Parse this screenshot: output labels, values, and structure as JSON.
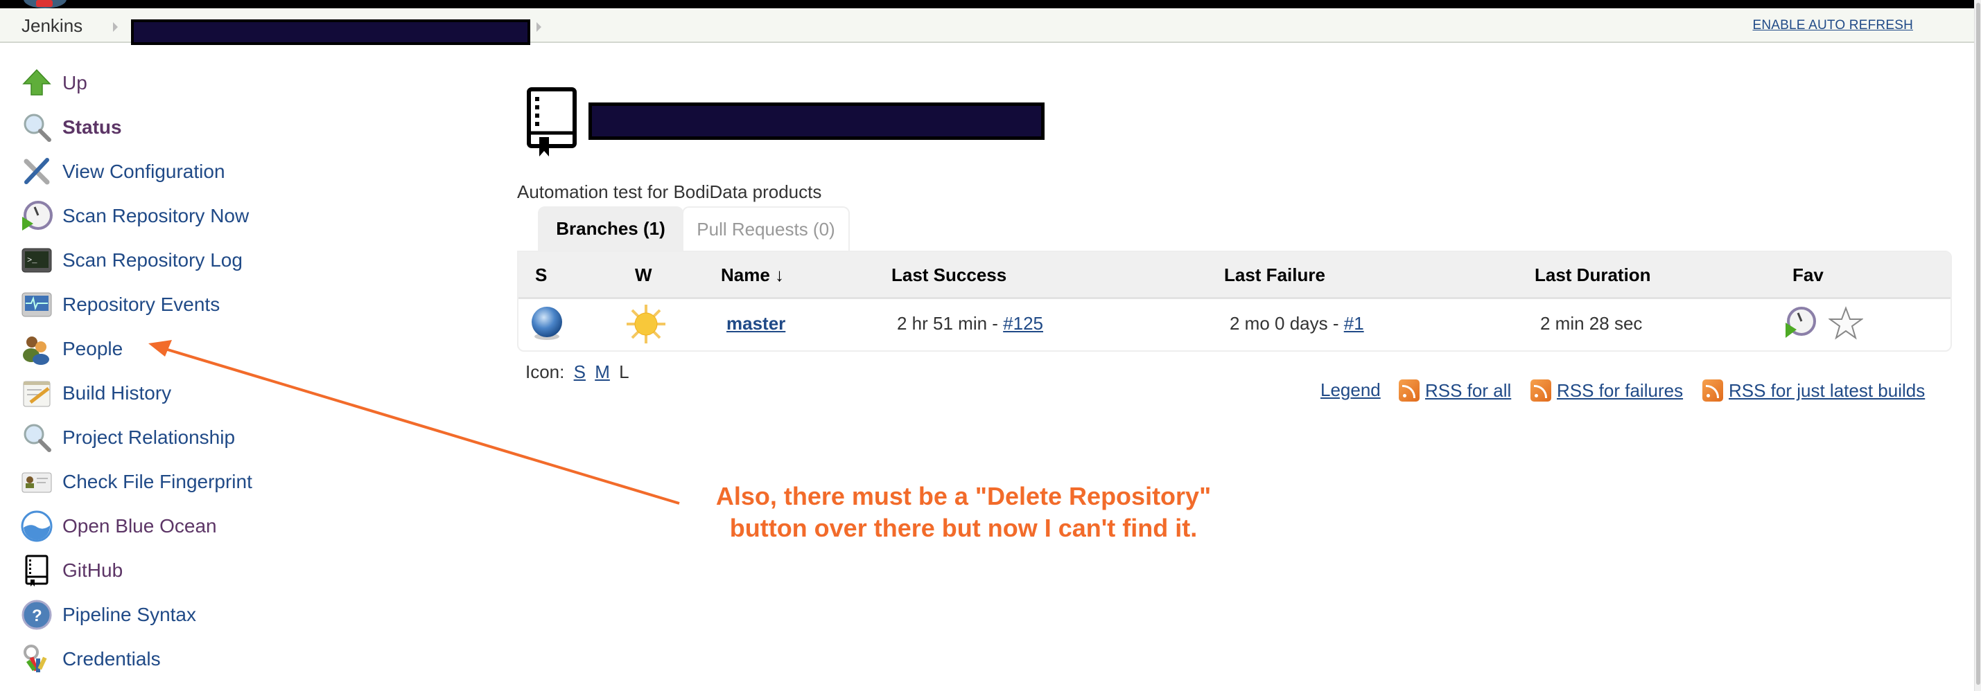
{
  "breadcrumb": {
    "root": "Jenkins",
    "redacted_item": "[redacted]",
    "auto_refresh": "ENABLE AUTO REFRESH"
  },
  "sidebar": {
    "items": [
      {
        "label": "Up",
        "icon": "up-arrow-icon",
        "visited": true
      },
      {
        "label": "Status",
        "icon": "magnifier-icon",
        "visited": true,
        "current": true
      },
      {
        "label": "View Configuration",
        "icon": "tools-icon"
      },
      {
        "label": "Scan Repository Now",
        "icon": "clock-play-icon"
      },
      {
        "label": "Scan Repository Log",
        "icon": "terminal-icon"
      },
      {
        "label": "Repository Events",
        "icon": "monitor-pulse-icon"
      },
      {
        "label": "People",
        "icon": "people-icon"
      },
      {
        "label": "Build History",
        "icon": "notepad-icon"
      },
      {
        "label": "Project Relationship",
        "icon": "magnifier-icon"
      },
      {
        "label": "Check File Fingerprint",
        "icon": "fingerprint-card-icon"
      },
      {
        "label": "Open Blue Ocean",
        "icon": "blue-ocean-icon",
        "visited": true
      },
      {
        "label": "GitHub",
        "icon": "repo-book-icon",
        "visited": true
      },
      {
        "label": "Pipeline Syntax",
        "icon": "help-icon"
      },
      {
        "label": "Credentials",
        "icon": "keys-icon"
      }
    ]
  },
  "main": {
    "title_redacted": "[redacted]",
    "description": "Automation test for BodiData products",
    "tabs": [
      {
        "label": "Branches (1)",
        "active": true
      },
      {
        "label": "Pull Requests (0)",
        "active": false
      }
    ],
    "table": {
      "headers": [
        "S",
        "W",
        "Name ↓",
        "Last Success",
        "Last Failure",
        "Last Duration",
        "Fav"
      ],
      "rows": [
        {
          "status": "blue-ball-icon",
          "weather": "sunny-icon",
          "name": "master",
          "last_success_time": "2 hr 51 min - ",
          "last_success_build": "#125",
          "last_failure_time": "2 mo 0 days - ",
          "last_failure_build": "#1",
          "last_duration": "2 min 28 sec"
        }
      ]
    },
    "icon_size": {
      "label": "Icon:",
      "options": [
        "S",
        "M",
        "L"
      ],
      "current": "L"
    },
    "footer_links": {
      "legend": "Legend",
      "rss_all": "RSS for all",
      "rss_failures": "RSS for failures",
      "rss_latest": "RSS for just latest builds"
    }
  },
  "annotation": {
    "line1": "Also, there must be a \"Delete Repository\"",
    "line2": "button over there but now I can't find it.",
    "color": "#f26b2a"
  },
  "colors": {
    "link": "#204a87",
    "visited": "#5c3566",
    "breadcrumb_bg": "#f5f7f2"
  }
}
